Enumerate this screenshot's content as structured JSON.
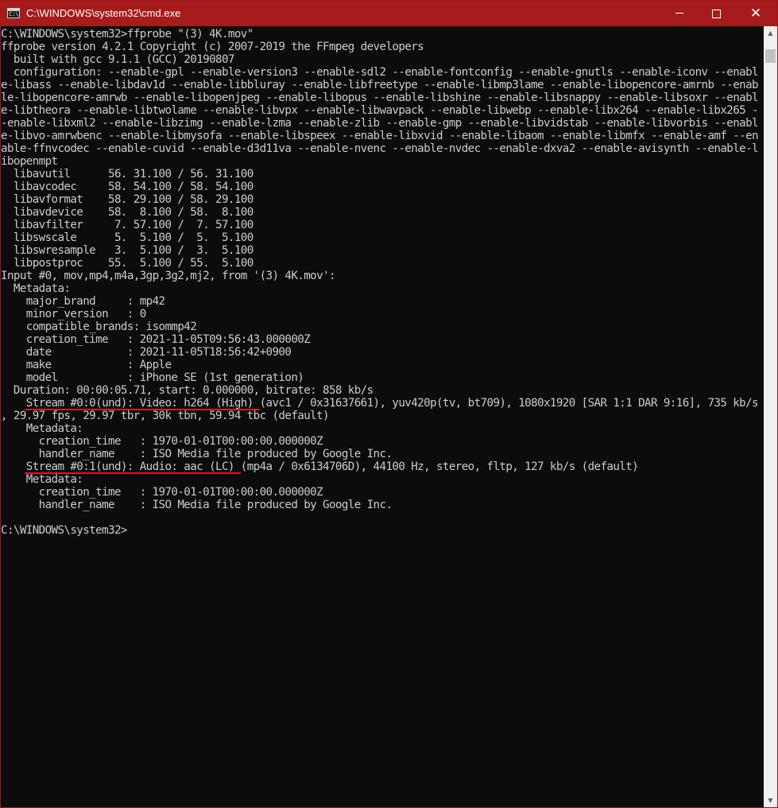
{
  "window": {
    "title": "C:\\WINDOWS\\system32\\cmd.exe",
    "controls": {
      "minimize": "",
      "maximize": "",
      "close": "✕"
    },
    "colors": {
      "titlebar": "#a61b1b",
      "console_bg": "#0c0c0c",
      "console_text": "#cccccc",
      "annotation": "#e01818"
    }
  },
  "console": {
    "lines": [
      "C:\\WINDOWS\\system32>ffprobe \"(3) 4K.mov\"",
      "ffprobe version 4.2.1 Copyright (c) 2007-2019 the FFmpeg developers",
      "  built with gcc 9.1.1 (GCC) 20190807",
      "  configuration: --enable-gpl --enable-version3 --enable-sdl2 --enable-fontconfig --enable-gnutls --enable-iconv --enabl",
      "e-libass --enable-libdav1d --enable-libbluray --enable-libfreetype --enable-libmp3lame --enable-libopencore-amrnb --enab",
      "le-libopencore-amrwb --enable-libopenjpeg --enable-libopus --enable-libshine --enable-libsnappy --enable-libsoxr --enabl",
      "e-libtheora --enable-libtwolame --enable-libvpx --enable-libwavpack --enable-libwebp --enable-libx264 --enable-libx265 -",
      "-enable-libxml2 --enable-libzimg --enable-lzma --enable-zlib --enable-gmp --enable-libvidstab --enable-libvorbis --enabl",
      "e-libvo-amrwbenc --enable-libmysofa --enable-libspeex --enable-libxvid --enable-libaom --enable-libmfx --enable-amf --en",
      "able-ffnvcodec --enable-cuvid --enable-d3d11va --enable-nvenc --enable-nvdec --enable-dxva2 --enable-avisynth --enable-l",
      "ibopenmpt",
      "  libavutil      56. 31.100 / 56. 31.100",
      "  libavcodec     58. 54.100 / 58. 54.100",
      "  libavformat    58. 29.100 / 58. 29.100",
      "  libavdevice    58.  8.100 / 58.  8.100",
      "  libavfilter     7. 57.100 /  7. 57.100",
      "  libswscale      5.  5.100 /  5.  5.100",
      "  libswresample   3.  5.100 /  3.  5.100",
      "  libpostproc    55.  5.100 / 55.  5.100",
      "Input #0, mov,mp4,m4a,3gp,3g2,mj2, from '(3) 4K.mov':",
      "  Metadata:",
      "    major_brand     : mp42",
      "    minor_version   : 0",
      "    compatible_brands: isommp42",
      "    creation_time   : 2021-11-05T09:56:43.000000Z",
      "    date            : 2021-11-05T18:56:42+0900",
      "    make            : Apple",
      "    model           : iPhone SE (1st generation)",
      "  Duration: 00:00:05.71, start: 0.000000, bitrate: 858 kb/s",
      "    Stream #0:0(und): Video: h264 (High) (avc1 / 0x31637661), yuv420p(tv, bt709), 1080x1920 [SAR 1:1 DAR 9:16], 735 kb/s",
      ", 29.97 fps, 29.97 tbr, 30k tbn, 59.94 tbc (default)",
      "    Metadata:",
      "      creation_time   : 1970-01-01T00:00:00.000000Z",
      "      handler_name    : ISO Media file produced by Google Inc.",
      "    Stream #0:1(und): Audio: aac (LC) (mp4a / 0x6134706D), 44100 Hz, stereo, fltp, 127 kb/s (default)",
      "    Metadata:",
      "      creation_time   : 1970-01-01T00:00:00.000000Z",
      "      handler_name    : ISO Media file produced by Google Inc.",
      "",
      "C:\\WINDOWS\\system32>"
    ]
  },
  "scrollbar": {
    "up_arrow_icon": "triangle-up",
    "down_arrow_icon": "triangle-down"
  }
}
